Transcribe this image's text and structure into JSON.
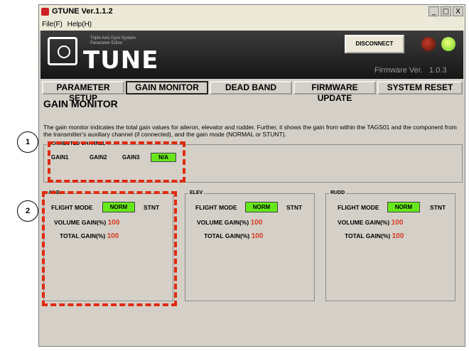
{
  "window": {
    "title": "GTUNE Ver.1.1.2",
    "controls": [
      "_",
      "□",
      "X"
    ]
  },
  "menu": {
    "items": [
      "File(F)",
      "Help(H)"
    ]
  },
  "header": {
    "tagline_line1": "Triple Axis Gyro System",
    "tagline_line2": "Parameter Editor",
    "logo_text": "TUNE",
    "disconnect_label": "DISCONNECT",
    "firmware_label": "Firmware Ver.",
    "firmware_version": "1.0.3"
  },
  "tabs": [
    {
      "label": "PARAMETER SETUP"
    },
    {
      "label": "GAIN MONITOR"
    },
    {
      "label": "DEAD BAND"
    },
    {
      "label": "FIRMWARE UPDATE"
    },
    {
      "label": "SYSTEM RESET"
    }
  ],
  "page": {
    "title": "GAIN MONITOR",
    "description": "The gain monitor indicates the total gain values for aileron, elevator and rudder. Further, it shows the gain from within the TAGS01 and the component from the transmitter's auxiliary channel (if connected), and the gain mode (NORMAL or STUNT)."
  },
  "connected_channel": {
    "label": "CONNECTED CHANNEL",
    "channels": [
      "GAIN1",
      "GAIN2",
      "GAIN3"
    ],
    "badge": "N/A"
  },
  "panels": [
    {
      "label": "AILE",
      "flight_mode_label": "FLIGHT MODE",
      "norm": "NORM",
      "stnt": "STNT",
      "volume_label": "VOLUME GAIN(%)",
      "volume_value": "100",
      "total_label": "TOTAL GAIN(%)",
      "total_value": "100"
    },
    {
      "label": "ELEV",
      "flight_mode_label": "FLIGHT MODE",
      "norm": "NORM",
      "stnt": "STNT",
      "volume_label": "VOLUME GAIN(%)",
      "volume_value": "100",
      "total_label": "TOTAL GAIN(%)",
      "total_value": "100"
    },
    {
      "label": "RUDD",
      "flight_mode_label": "FLIGHT MODE",
      "norm": "NORM",
      "stnt": "STNT",
      "volume_label": "VOLUME GAIN(%)",
      "volume_value": "100",
      "total_label": "TOTAL GAIN(%)",
      "total_value": "100"
    }
  ],
  "callouts": [
    "1",
    "2"
  ],
  "colors": {
    "accent_green": "#66e81a",
    "value_red": "#d53a1e",
    "highlight_dash": "#e02a10"
  }
}
